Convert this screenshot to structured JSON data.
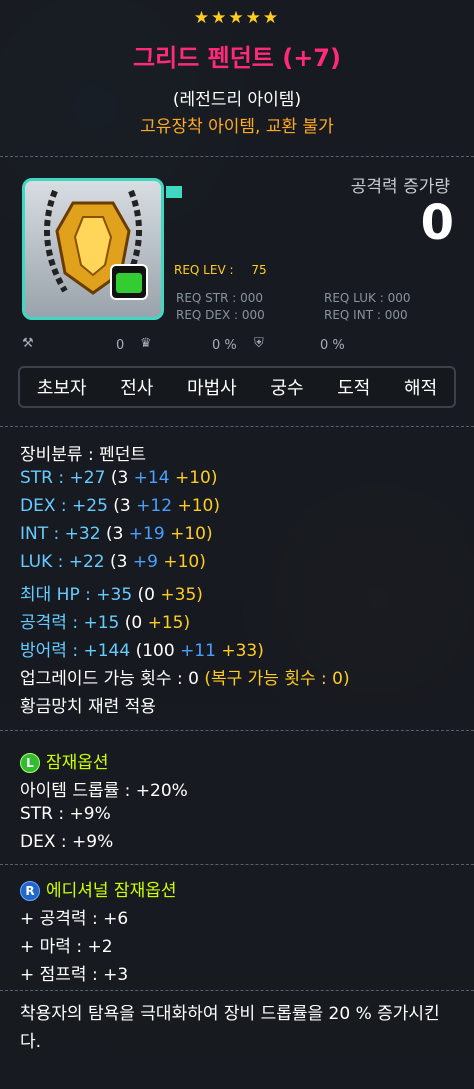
{
  "item": {
    "stars": "★★★★★",
    "name": "그리드 펜던트 (+7)",
    "grade": "(레전드리 아이템)",
    "trade": "고유장착 아이템, 교환 불가"
  },
  "compare": {
    "label": "공격력 증가량",
    "value": "0"
  },
  "requirements": {
    "level_label": "REQ LEV :",
    "level_value": "75",
    "str": "REQ STR : 000",
    "luk": "REQ LUK : 000",
    "dex": "REQ DEX : 000",
    "int": "REQ INT : 000"
  },
  "flags": {
    "a": "0",
    "b": "0 %",
    "c": "0 %"
  },
  "jobs": [
    "초보자",
    "전사",
    "마법사",
    "궁수",
    "도적",
    "해적"
  ],
  "stats": {
    "category": "장비분류 : 펜던트",
    "str": {
      "label": "STR : +27",
      "base": "(3",
      "star": "+14",
      "scroll": "+10)"
    },
    "dex": {
      "label": "DEX : +25",
      "base": "(3",
      "star": "+12",
      "scroll": "+10)"
    },
    "int": {
      "label": "INT : +32",
      "base": "(3",
      "star": "+19",
      "scroll": "+10)"
    },
    "luk": {
      "label": "LUK : +22",
      "base": "(3",
      "star": "+9",
      "scroll": "+10)"
    },
    "hp": {
      "label": "최대 HP : +35",
      "base": "(0",
      "scroll": "+35)"
    },
    "atk": {
      "label": "공격력 : +15",
      "base": "(0",
      "scroll": "+15)"
    },
    "def": {
      "label": "방어력 : +144",
      "base": "(100",
      "star": "+11",
      "scroll": "+33)"
    },
    "upgrade": "업그레이드 가능 횟수 : 0",
    "restore": "(복구 가능 횟수 : 0)",
    "hammer": "황금망치 재련 적용"
  },
  "potential": {
    "badge": "L",
    "title": "잠재옵션",
    "lines": [
      "아이템 드롭률 : +20%",
      "STR : +9%",
      "DEX : +9%"
    ]
  },
  "additional": {
    "badge": "R",
    "title": "에디셔널 잠재옵션",
    "lines": [
      "+ 공격력 : +6",
      "+ 마력 : +2",
      "+ 점프력 : +3"
    ]
  },
  "description": "착용자의 탐욕을 극대화하여 장비 드롭률을 20 % 증가시킨다.",
  "colors": {
    "name": "#ff2a7a",
    "trade": "#ffaa22",
    "blue_stat": "#66ccff",
    "star_force": "#4aa0ff",
    "scroll": "#ffcc22",
    "potential": "#ccff00",
    "border": "#3fd8c0"
  }
}
